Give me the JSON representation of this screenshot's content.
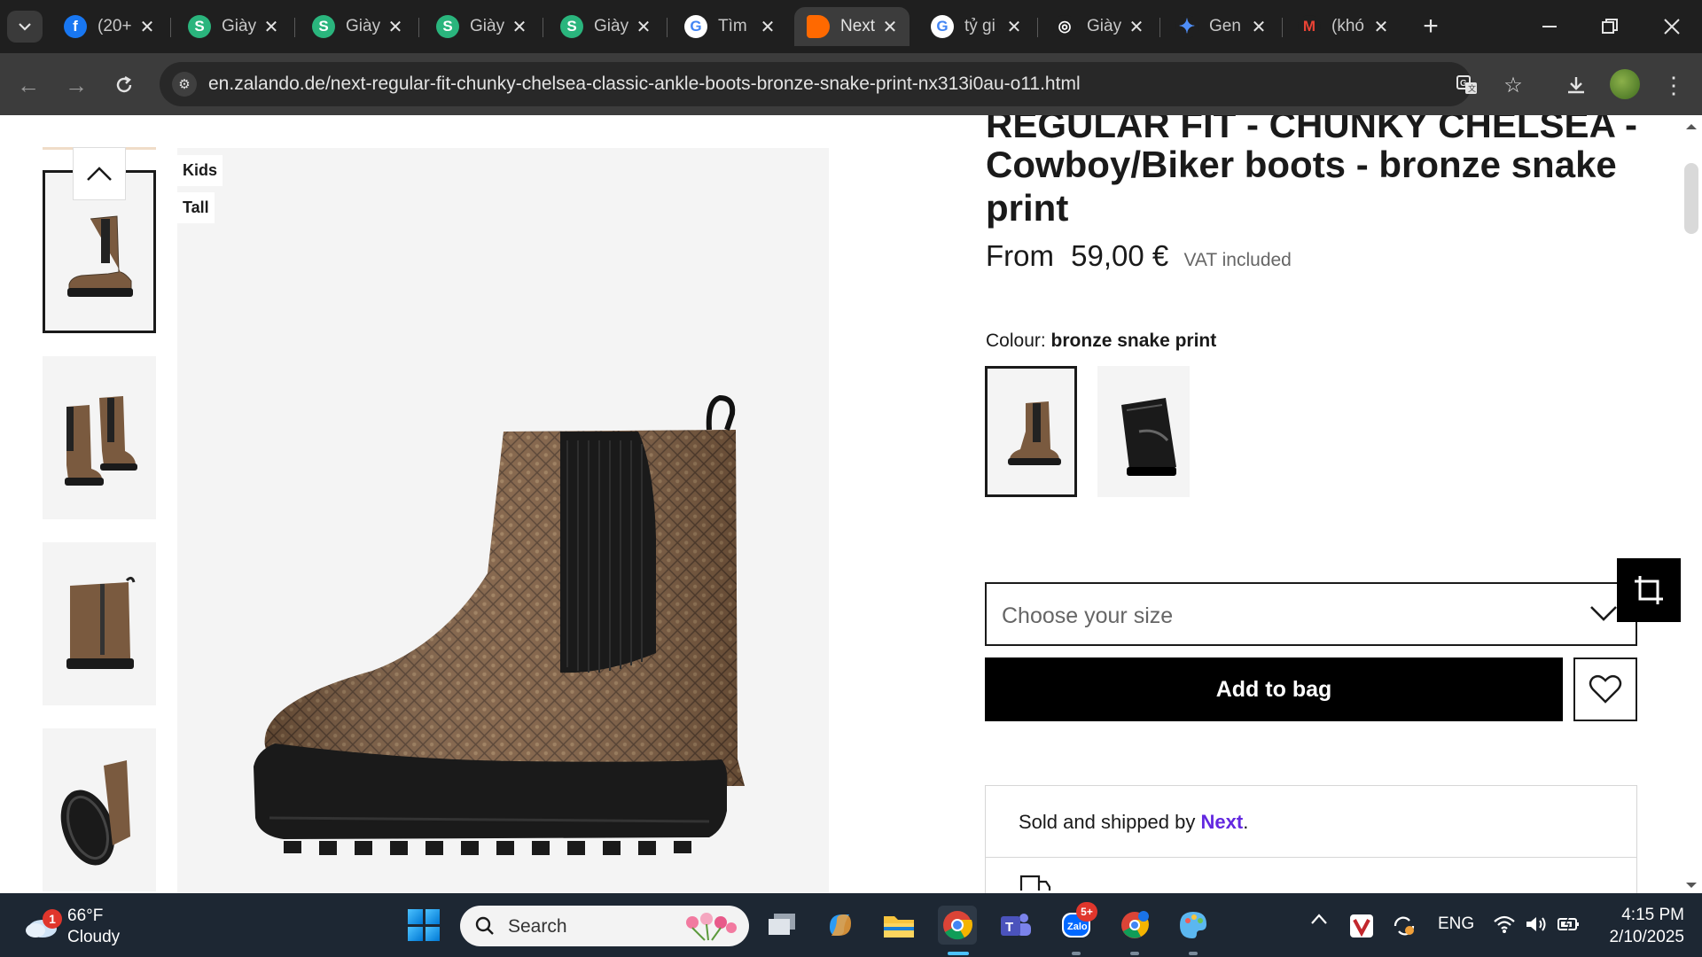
{
  "browser": {
    "tabs": [
      {
        "title": "(20+",
        "icon": "facebook-icon",
        "color": "#1877f2",
        "glyph": "f"
      },
      {
        "title": "Giày",
        "icon": "s-app-icon",
        "color": "#2ab57d",
        "glyph": "S"
      },
      {
        "title": "Giày",
        "icon": "s-app-icon",
        "color": "#2ab57d",
        "glyph": "S"
      },
      {
        "title": "Giày",
        "icon": "s-app-icon",
        "color": "#2ab57d",
        "glyph": "S"
      },
      {
        "title": "Giày",
        "icon": "s-app-icon",
        "color": "#2ab57d",
        "glyph": "S"
      },
      {
        "title": "Tìm",
        "icon": "google-icon",
        "color": "#ffffff",
        "glyph": "G"
      },
      {
        "title": "Next",
        "icon": "zalando-icon",
        "color": "#ff6900",
        "glyph": "",
        "active": true
      },
      {
        "title": "tỷ gi",
        "icon": "google-icon",
        "color": "#ffffff",
        "glyph": "G"
      },
      {
        "title": "Giày",
        "icon": "chatgpt-icon",
        "color": "#1f1f1f",
        "glyph": "◎"
      },
      {
        "title": "Gen",
        "icon": "gemini-icon",
        "color": "#1f1f1f",
        "glyph": "✦"
      },
      {
        "title": "(khó",
        "icon": "gmail-icon",
        "color": "#1f1f1f",
        "glyph": "M"
      }
    ],
    "url": "en.zalando.de/next-regular-fit-chunky-chelsea-classic-ankle-boots-bronze-snake-print-nx313i0au-o11.html"
  },
  "product": {
    "flags": [
      "Kids",
      "Tall"
    ],
    "title_cut": "REGULAR FIT - CHUNKY CHELSEA -",
    "title": "Cowboy/Biker boots - bronze snake print",
    "price_prefix": "From",
    "price": "59,00 €",
    "vat": "VAT included",
    "colour_label": "Colour:",
    "colour_value": "bronze snake print",
    "size_placeholder": "Choose your size",
    "add_to_bag": "Add to bag",
    "sold_by_prefix": "Sold and shipped by",
    "sold_by_name": "Next",
    "sold_by_suffix": "."
  },
  "taskbar": {
    "weather_badge": "1",
    "temperature": "66°F",
    "condition": "Cloudy",
    "search_label": "Search",
    "zalo_badge": "5+",
    "language": "ENG",
    "time": "4:15 PM",
    "date": "2/10/2025"
  },
  "colors": {
    "accent_link": "#6328e0",
    "boot_brown": "#7a5a3f",
    "taskbar": "#1d2733"
  }
}
